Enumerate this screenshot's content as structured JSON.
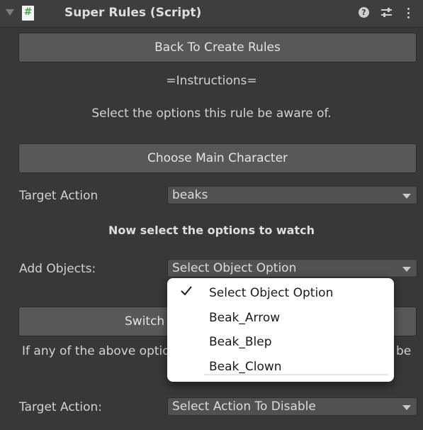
{
  "header": {
    "title": "Super Rules (Script)",
    "script_icon_glyph": "#",
    "icons": [
      "foldout-arrow-icon",
      "script-file-icon",
      "help-icon",
      "preset-sliders-icon",
      "more-vertical-icon"
    ]
  },
  "buttons": {
    "back": "Back To Create Rules",
    "choose_main": "Choose Main Character",
    "switch": "Switch"
  },
  "text": {
    "instructions": "=Instructions=",
    "select_options": "Select the options this rule be aware of.",
    "now_select": "Now select the options to watch",
    "if_any": "If any of the above optio",
    "wrap_tail": "be"
  },
  "fields": {
    "target_action_label": "Target Action",
    "target_action_value": "beaks",
    "add_objects_label": "Add Objects:",
    "add_objects_value": "Select Object Option",
    "target_action2_label": "Target Action:",
    "target_action2_value": "Select Action To Disable"
  },
  "popup": {
    "selected": "Select Object Option",
    "options": [
      "Select Object Option",
      "Beak_Arrow",
      "Beak_Blep",
      "Beak_Clown"
    ]
  },
  "colors": {
    "background": "#383838",
    "button": "#585858",
    "dropdown": "#515151",
    "popup": "#ffffff",
    "script_icon_accent": "#3ea84a"
  }
}
